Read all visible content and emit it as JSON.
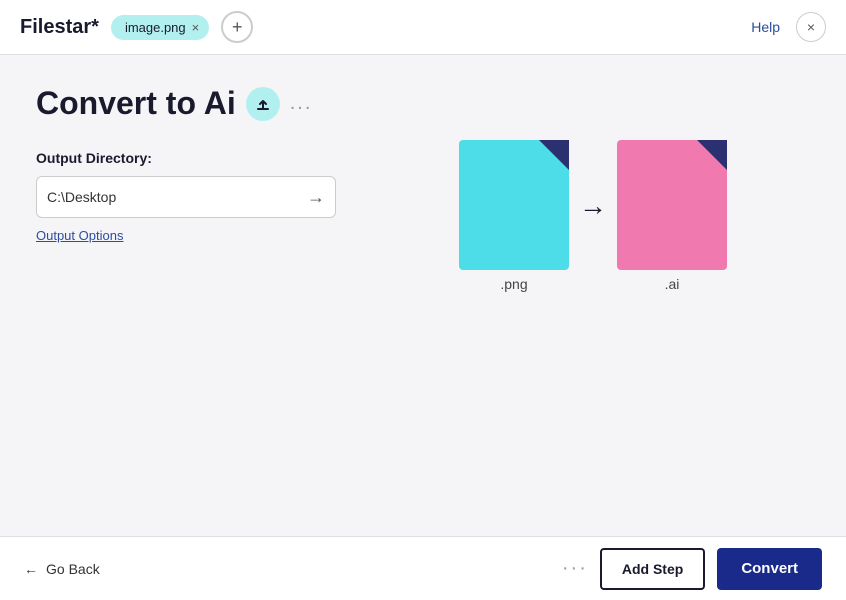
{
  "header": {
    "title": "Filestar*",
    "file_chip": {
      "label": "image.png",
      "close_label": "×"
    },
    "add_tab_label": "+",
    "help_label": "Help",
    "close_label": "×"
  },
  "main": {
    "page_title": "Convert to Ai",
    "upload_badge_icon": "upload-icon",
    "more_dots": "...",
    "output_directory": {
      "label": "Output Directory:",
      "value": "C:\\Desktop",
      "placeholder": "C:\\Desktop",
      "options_link": "Output Options"
    }
  },
  "illustration": {
    "source_label": ".png",
    "target_label": ".ai",
    "arrow": "→"
  },
  "footer": {
    "go_back_label": "Go Back",
    "dots": "···",
    "add_step_label": "Add Step",
    "convert_label": "Convert"
  }
}
